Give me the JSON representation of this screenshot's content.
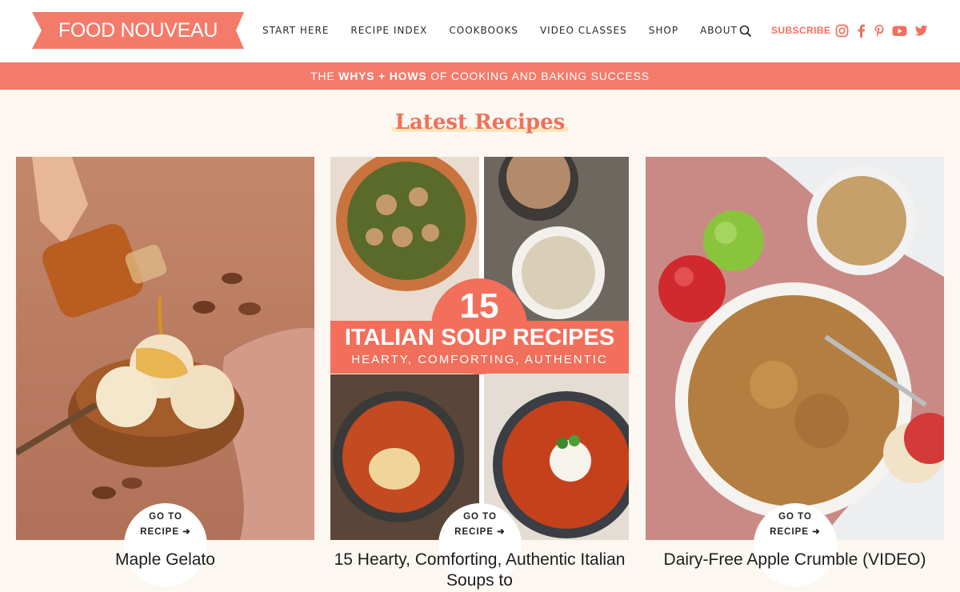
{
  "brand": {
    "name": "FOOD NOUVEAU",
    "color": "#f26f5c"
  },
  "nav": {
    "items": [
      "START HERE",
      "RECIPE INDEX",
      "COOKBOOKS",
      "VIDEO CLASSES",
      "SHOP",
      "ABOUT"
    ],
    "search_icon": "search-icon",
    "subscribe_label": "SUBSCRIBE",
    "social": [
      "instagram-icon",
      "facebook-icon",
      "pinterest-icon",
      "youtube-icon",
      "twitter-icon"
    ]
  },
  "tagline": {
    "prefix": "THE ",
    "whys": "WHYS",
    "plus": " + ",
    "hows": "HOWS",
    "suffix": " OF COOKING AND BAKING SUCCESS"
  },
  "section": {
    "title": "Latest Recipes"
  },
  "recipes": [
    {
      "title": "Maple Gelato",
      "badge_line1": "GO TO",
      "badge_line2": "RECIPE ➜"
    },
    {
      "title": "15 Hearty, Comforting, Authentic Italian Soups to",
      "badge_line1": "GO TO",
      "badge_line2": "RECIPE ➜",
      "overlay_number": "15",
      "overlay_title": "ITALIAN SOUP RECIPES",
      "overlay_subtitle": "HEARTY, COMFORTING, AUTHENTIC"
    },
    {
      "title": "Dairy-Free Apple Crumble (VIDEO)",
      "badge_line1": "GO TO",
      "badge_line2": "RECIPE ➜"
    }
  ]
}
